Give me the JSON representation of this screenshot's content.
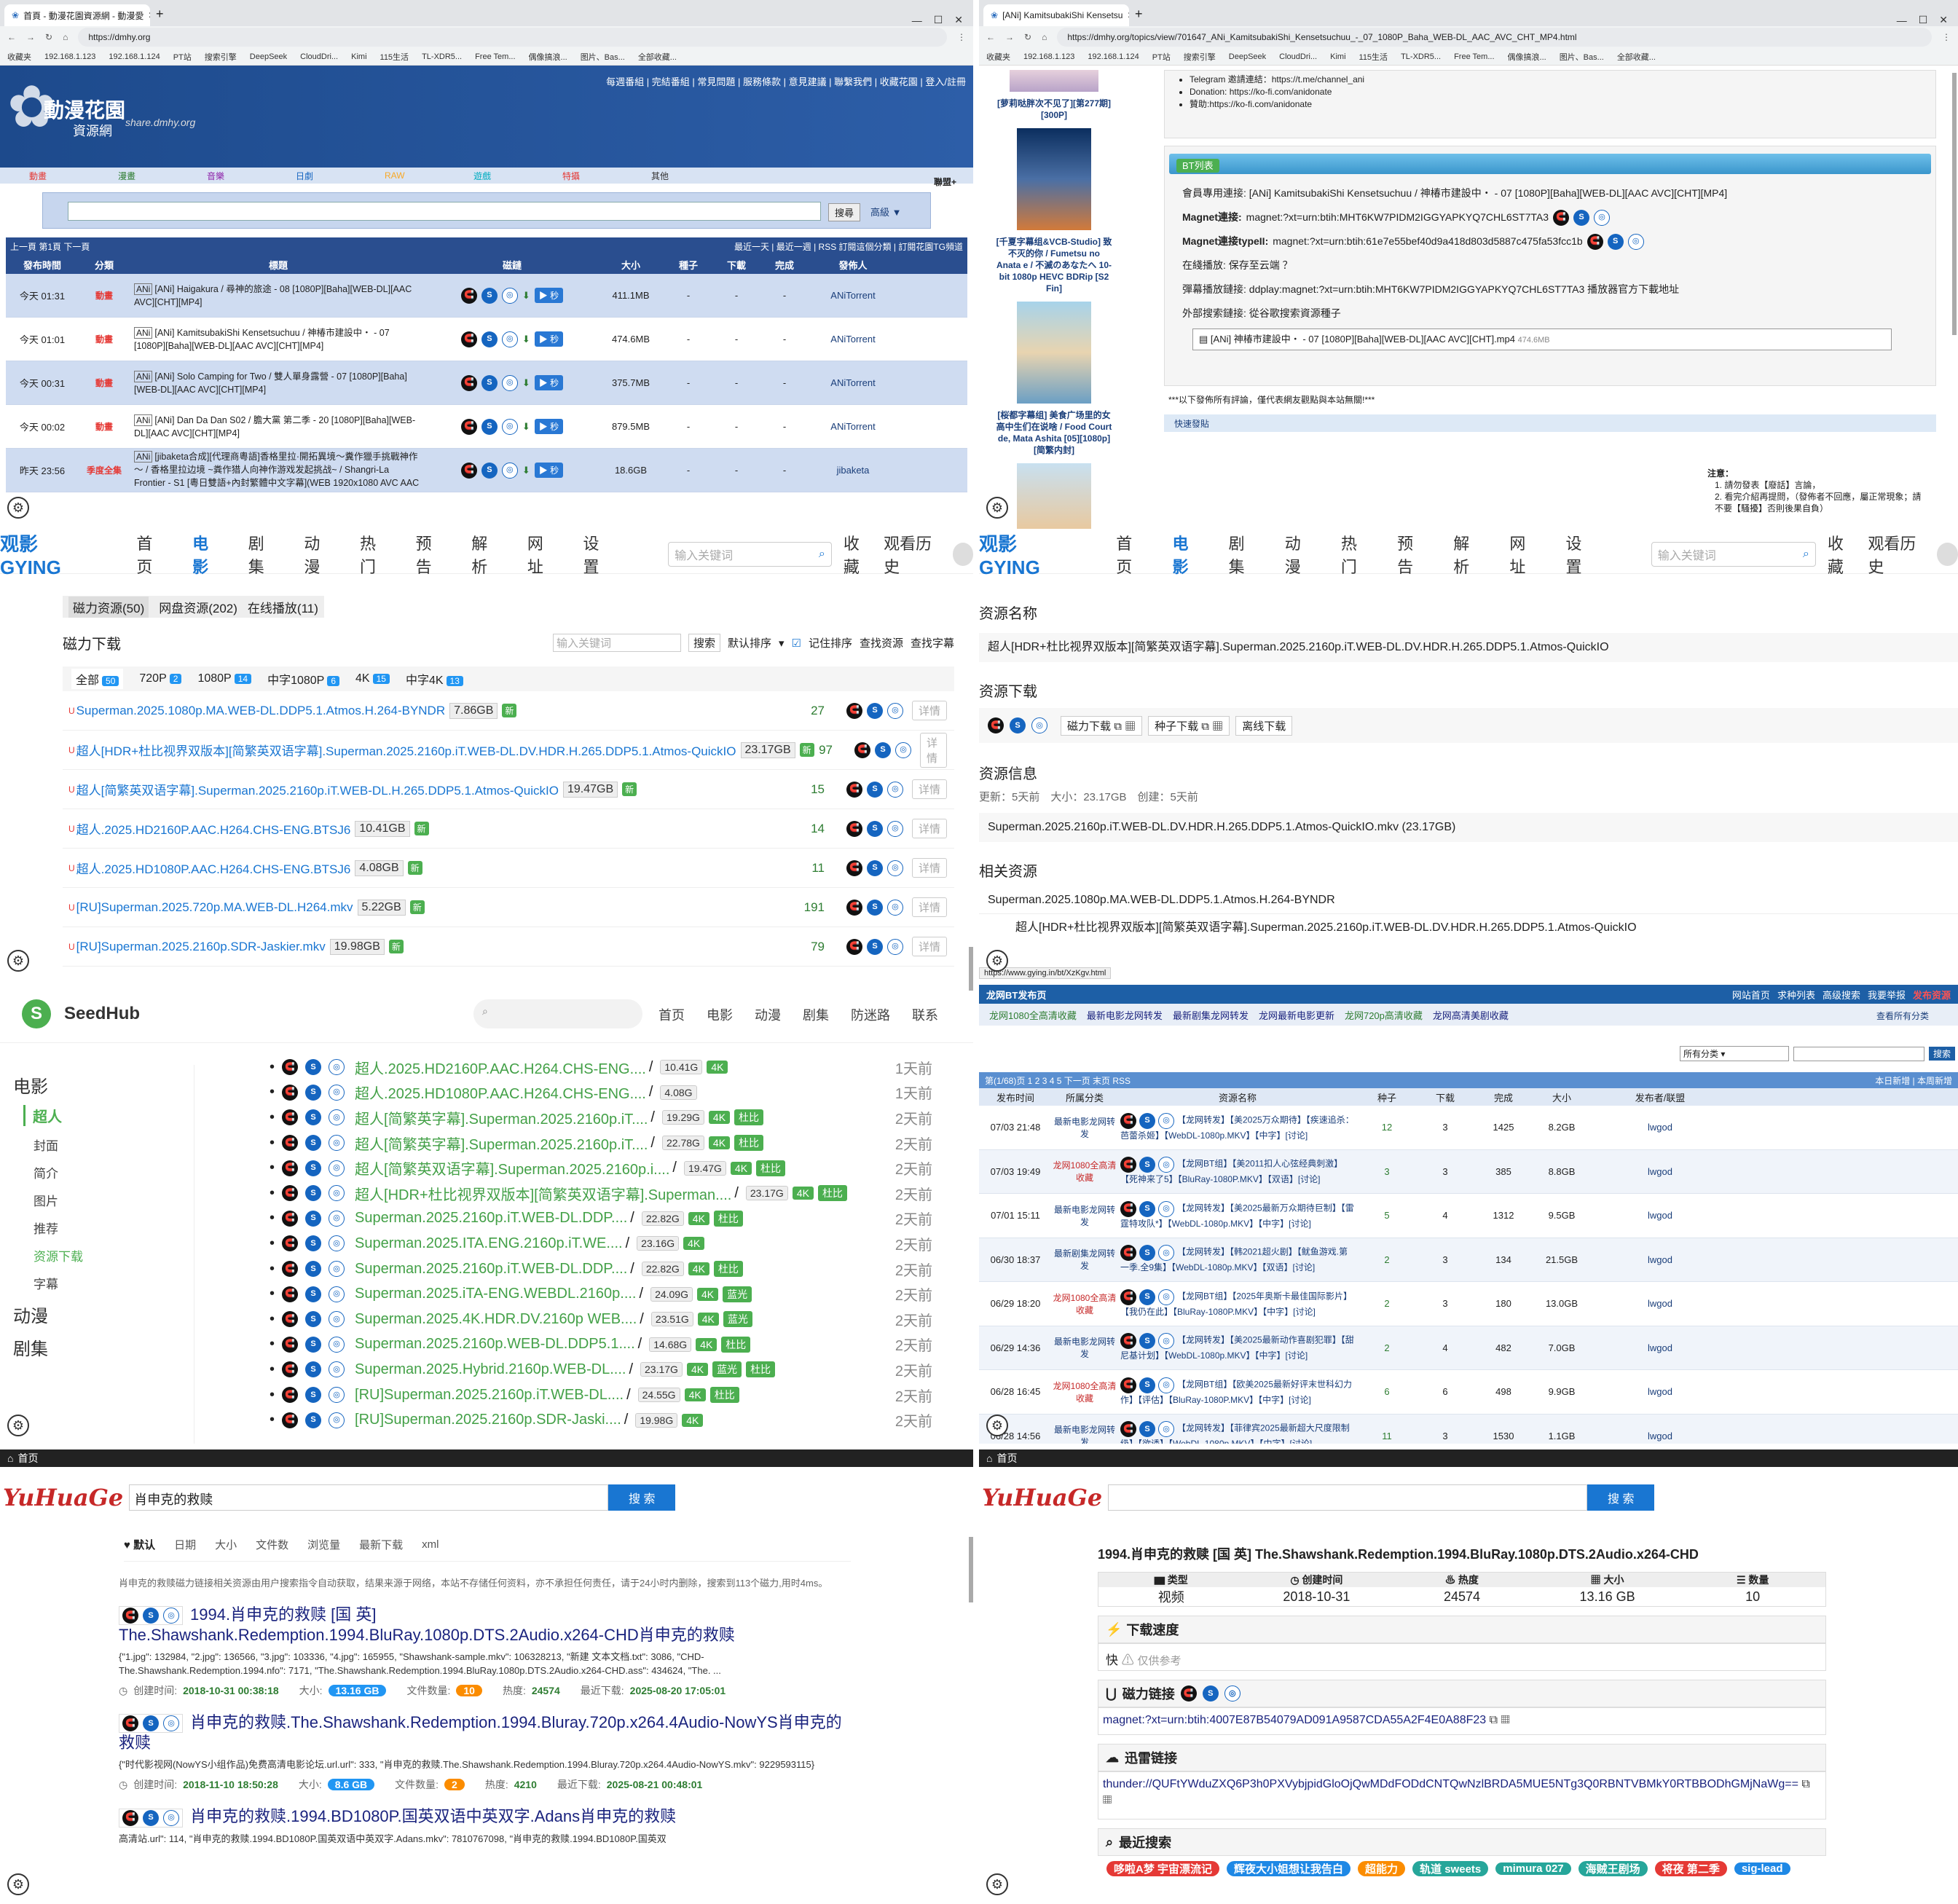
{
  "dmhy": {
    "tab_title": "首頁 - 動漫花園資源網 - 動漫愛",
    "url": "https://dmhy.org",
    "bookmarks": [
      "收藏夹",
      "192.168.1.123",
      "192.168.1.124",
      "PT站",
      "搜索引擎",
      "DeepSeek",
      "CloudDri...",
      "Kimi",
      "115生活",
      "TL-XDR5...",
      "Free Tem...",
      "偶像搞浪...",
      "图片、Bas...",
      "全部收藏..."
    ],
    "logo": "動漫花園",
    "logo_sub": "資源網",
    "logo_url": "share.dmhy.org",
    "toplinks": "每週番組 | 完結番組 | 常見問題 | 服務條款 | 意見建議 | 聯繫我們 | 收藏花園 | 登入/註冊",
    "cats": [
      "動畫",
      "漫畫",
      "音樂",
      "日劇",
      "RAW",
      "遊戲",
      "特攝",
      "其他"
    ],
    "cat_colors": [
      "#e53935",
      "#2e7d32",
      "#8e24aa",
      "#1565c0",
      "#f9a825",
      "#00acc1",
      "#e53935",
      "#333333"
    ],
    "league": "聯盟+",
    "search_btn": "搜尋",
    "adv": "高級 ▼",
    "pager": "上一頁 第1頁 下一頁",
    "bar_right": "最近一天 | 最近一週 | RSS 訂閱這個分類 | 訂閱花園TG頻道",
    "headers": [
      "發布時間",
      "分類",
      "標題",
      "磁鏈",
      "大小",
      "種子",
      "下載",
      "完成",
      "發佈人"
    ],
    "rows": [
      {
        "time": "今天 01:31",
        "cat": "動畫",
        "title": "[ANi] Haigakura / 尋神的旅途 - 08 [1080P][Baha][WEB-DL][AAC AVC][CHT][MP4]",
        "size": "411.1MB",
        "seed": "-",
        "dl": "-",
        "done": "-",
        "pub": "ANiTorrent"
      },
      {
        "time": "今天 01:01",
        "cat": "動畫",
        "title": "[ANi] KamitsubakiShi Kensetsuchuu / 神椿市建設中・ - 07 [1080P][Baha][WEB-DL][AAC AVC][CHT][MP4]",
        "size": "474.6MB",
        "seed": "-",
        "dl": "-",
        "done": "-",
        "pub": "ANiTorrent"
      },
      {
        "time": "今天 00:31",
        "cat": "動畫",
        "title": "[ANi] Solo Camping for Two / 雙人單身露營 - 07 [1080P][Baha][WEB-DL][AAC AVC][CHT][MP4]",
        "size": "375.7MB",
        "seed": "-",
        "dl": "-",
        "done": "-",
        "pub": "ANiTorrent"
      },
      {
        "time": "今天 00:02",
        "cat": "動畫",
        "title": "[ANi] Dan Da Dan S02 / 膽大黨 第二季 - 20 [1080P][Baha][WEB-DL][AAC AVC][CHT][MP4]",
        "size": "879.5MB",
        "seed": "-",
        "dl": "-",
        "done": "-",
        "pub": "ANiTorrent"
      },
      {
        "time": "昨天 23:56",
        "cat": "季度全集",
        "title": "[jibaketa合成][代理商粵語]香格里拉·開拓異境～糞作獵手挑戰神作～ / 香格里拉边境 ~粪作猎人向神作游戏发起挑战~ / Shangri-La Frontier - S1 [粵日雙語+內封繁體中文字幕](WEB 1920x1080 AVC AAC SRT)",
        "size": "18.6GB",
        "seed": "-",
        "dl": "-",
        "done": "-",
        "pub": "jibaketa"
      }
    ],
    "second": "秒"
  },
  "dmhy2": {
    "tab_title": "[ANi] KamitsubakiShi Kensetsu",
    "url": "https://dmhy.org/topics/view/701647_ANi_KamitsubakiShi_Kensetsuchuu_-_07_1080P_Baha_WEB-DL_AAC_AVC_CHT_MP4.html",
    "side": [
      "[萝莉哒胖次不见了][第277期][300P]",
      "[千夏字幕组&VCB-Studio] 致不灭的你 / Fumetsu no Anata e / 不滅のあなたへ 10-bit 1080p HEVC BDRip [S2 Fin]",
      "[桜都字幕组] 美食广场里的女高中生们在说啥 / Food Court de, Mata Ashita [05][1080p][简繁内封]"
    ],
    "info": [
      "Telegram 邀請連結：https://t.me/channel_ani",
      "Donation: https://ko-fi.com/anidonate",
      "贊助:https://ko-fi.com/anidonate"
    ],
    "bt_title": "BT列表",
    "l1": "會員專用連接: [ANi] KamitsubakiShi Kensetsuchuu / 神椿市建設中・ - 07 [1080P][Baha][WEB-DL][AAC AVC][CHT][MP4]",
    "l2k": "Magnet連接:",
    "l2": "magnet:?xt=urn:btih:MHT6KW7PIDM2IGGYAPKYQ7CHL6ST7TA3",
    "l3k": "Magnet連接typeII:",
    "l3": "magnet:?xt=urn:btih:61e7e55bef40d9a418d803d5887c475fa53fcc1b",
    "l4": "在綫播放: 保存至云端 ？",
    "l5": "彈幕播放鏈接: ddplay:magnet:?xt=urn:btih:MHT6KW7PIDM2IGGYAPKYQ7CHL6ST7TA3 播放器官方下載地址",
    "l6": "外部搜索鏈接: 從谷歌搜索資源種子",
    "file": "[ANi] 神椿市建設中・ - 07 [1080P][Baha][WEB-DL][AAC AVC][CHT].mp4",
    "file_size": "474.6MB",
    "notice": "***以下發佈所有評論，僅代表網友觀點與本站無關!***",
    "quick": "快速發貼",
    "note_h": "注意：",
    "notes": [
      "1. 請勿發表【廢話】言論，",
      "2. 看完介紹再提問，（發佈者不回應，屬正常現象；請不要【騷擾】否則後果自負）"
    ]
  },
  "gying": {
    "logo": "观影 GYING",
    "nav": [
      "首页",
      "电影",
      "剧集",
      "动漫",
      "热门",
      "预告",
      "解析",
      "网址",
      "设置"
    ],
    "search_ph": "输入关键词",
    "nav_right": [
      "收藏",
      "观看历史"
    ],
    "tabs": [
      "磁力资源(50)",
      "网盘资源(202)",
      "在线播放(11)"
    ],
    "section": "磁力下载",
    "filter_ph": "输入关键词",
    "filter_btn": "搜索",
    "sort": "默认排序",
    "remember": "记住排序",
    "find_res": "查找资源",
    "find_sub": "查找字幕",
    "qtabs": [
      {
        "l": "全部",
        "n": "50"
      },
      {
        "l": "720P",
        "n": "2"
      },
      {
        "l": "1080P",
        "n": "14"
      },
      {
        "l": "中字1080P",
        "n": "6"
      },
      {
        "l": "4K",
        "n": "15"
      },
      {
        "l": "中字4K",
        "n": "13"
      }
    ],
    "new": "新",
    "detail": "详情",
    "rows": [
      {
        "t": "Superman.2025.1080p.MA.WEB-DL.DDP5.1.Atmos.H.264-BYNDR",
        "s": "7.86GB",
        "n": "27"
      },
      {
        "t": "超人[HDR+杜比视界双版本][简繁英双语字幕].Superman.2025.2160p.iT.WEB-DL.DV.HDR.H.265.DDP5.1.Atmos-QuickIO",
        "s": "23.17GB",
        "n": "97"
      },
      {
        "t": "超人[简繁英双语字幕].Superman.2025.2160p.iT.WEB-DL.H.265.DDP5.1.Atmos-QuickIO",
        "s": "19.47GB",
        "n": "15"
      },
      {
        "t": "超人.2025.HD2160P.AAC.H264.CHS-ENG.BTSJ6",
        "s": "10.41GB",
        "n": "14"
      },
      {
        "t": "超人.2025.HD1080P.AAC.H264.CHS-ENG.BTSJ6",
        "s": "4.08GB",
        "n": "11"
      },
      {
        "t": "[RU]Superman.2025.720p.MA.WEB-DL.H264.mkv",
        "s": "5.22GB",
        "n": "191"
      },
      {
        "t": "[RU]Superman.2025.2160p.SDR-Jaskier.mkv",
        "s": "19.98GB",
        "n": "79"
      }
    ]
  },
  "gying2": {
    "h1": "资源名称",
    "name": "超人[HDR+杜比视界双版本][简繁英双语字幕].Superman.2025.2160p.iT.WEB-DL.DV.HDR.H.265.DDP5.1.Atmos-QuickIO",
    "h2": "资源下载",
    "btns": [
      "磁力下载",
      "复",
      "种子下载",
      "复",
      "离线下载"
    ],
    "h3": "资源信息",
    "meta": "更新：5天前　大小：23.17GB　创建：5天前",
    "file": "Superman.2025.2160p.iT.WEB-DL.DV.HDR.H.265.DDP5.1.Atmos-QuickIO.mkv (23.17GB)",
    "h4": "相关资源",
    "rel": [
      "Superman.2025.1080p.MA.WEB-DL.DDP5.1.Atmos.H.264-BYNDR",
      "超人[HDR+杜比视界双版本][简繁英双语字幕].Superman.2025.2160p.iT.WEB-DL.DV.HDR.H.265.DDP5.1.Atmos-QuickIO"
    ],
    "status": "https://www.gying.in/bt/XzKgv.html"
  },
  "seedhub": {
    "logo": "SeedHub",
    "nav": [
      "首页",
      "电影",
      "动漫",
      "剧集",
      "防迷路",
      "联系"
    ],
    "side": [
      "电影",
      "超人",
      "封面",
      "简介",
      "图片",
      "推荐",
      "资源下载",
      "字幕",
      "动漫",
      "剧集"
    ],
    "rows": [
      {
        "t": "超人.2025.HD2160P.AAC.H264.CHS-ENG....",
        "s": "10.41G",
        "tags": [
          "4K"
        ],
        "d": "1天前"
      },
      {
        "t": "超人.2025.HD1080P.AAC.H264.CHS-ENG....",
        "s": "4.08G",
        "tags": [],
        "d": "1天前"
      },
      {
        "t": "超人[简繁英字幕].Superman.2025.2160p.iT....",
        "s": "19.29G",
        "tags": [
          "4K",
          "杜比"
        ],
        "d": "2天前"
      },
      {
        "t": "超人[简繁英字幕].Superman.2025.2160p.iT....",
        "s": "22.78G",
        "tags": [
          "4K",
          "杜比"
        ],
        "d": "2天前"
      },
      {
        "t": "超人[简繁英双语字幕].Superman.2025.2160p.i....",
        "s": "19.47G",
        "tags": [
          "4K",
          "杜比"
        ],
        "d": "2天前"
      },
      {
        "t": "超人[HDR+杜比视界双版本][简繁英双语字幕].Superman....",
        "s": "23.17G",
        "tags": [
          "4K",
          "杜比"
        ],
        "d": "2天前"
      },
      {
        "t": "Superman.2025.2160p.iT.WEB-DL.DDP....",
        "s": "22.82G",
        "tags": [
          "4K",
          "杜比"
        ],
        "d": "2天前"
      },
      {
        "t": "Superman.2025.ITA.ENG.2160p.iT.WE....",
        "s": "23.16G",
        "tags": [
          "4K"
        ],
        "d": "2天前"
      },
      {
        "t": "Superman.2025.2160p.iT.WEB-DL.DDP....",
        "s": "22.82G",
        "tags": [
          "4K",
          "杜比"
        ],
        "d": "2天前"
      },
      {
        "t": "Superman.2025.iTA-ENG.WEBDL.2160p....",
        "s": "24.09G",
        "tags": [
          "4K",
          "蓝光"
        ],
        "d": "2天前"
      },
      {
        "t": "Superman.2025.4K.HDR.DV.2160p WEB....",
        "s": "23.51G",
        "tags": [
          "4K",
          "蓝光"
        ],
        "d": "2天前"
      },
      {
        "t": "Superman.2025.2160p.WEB-DL.DDP5.1....",
        "s": "14.68G",
        "tags": [
          "4K",
          "杜比"
        ],
        "d": "2天前"
      },
      {
        "t": "Superman.2025.Hybrid.2160p.WEB-DL....",
        "s": "23.17G",
        "tags": [
          "4K",
          "蓝光",
          "杜比"
        ],
        "d": "2天前"
      },
      {
        "t": "[RU]Superman.2025.2160p.iT.WEB-DL....",
        "s": "24.55G",
        "tags": [
          "4K",
          "杜比"
        ],
        "d": "2天前"
      },
      {
        "t": "[RU]Superman.2025.2160p.SDR-Jaski....",
        "s": "19.98G",
        "tags": [
          "4K"
        ],
        "d": "2天前"
      }
    ]
  },
  "lw": {
    "title": "龙网BT发布页",
    "right": [
      "网站首页",
      "求种列表",
      "高级搜索",
      "我要举报",
      "发布资源"
    ],
    "links": [
      "龙网1080全高清收藏",
      "最新电影龙网转发",
      "最新剧集龙网转发",
      "龙网最新电影更新",
      "龙网720p高清收藏",
      "龙网高清美剧收藏"
    ],
    "link_colors": [
      "#2e7d32",
      "#1a237e",
      "#1a237e",
      "#1a237e",
      "#2e7d32",
      "#1a237e"
    ],
    "view_all": "查看所有分类",
    "cat_sel": "所有分类",
    "search_btn": "搜索",
    "pager": "第(1/68)页 1 2 3 4 5 下一页 末页 RSS",
    "pager_right": "本日新增 | 本周新增",
    "headers": [
      "发布时间",
      "所属分类",
      "资源名称",
      "种子",
      "下载",
      "完成",
      "大小",
      "发布者/联盟"
    ],
    "rows": [
      {
        "t": "07/03 21:48",
        "c": "最新电影龙网转发",
        "n": "【龙网转发】【美2025万众期待】【疾速追杀：芭蕾杀姬】【WebDL-1080p.MKV】【中字】[讨论]",
        "s": "12",
        "d": "3",
        "f": "1425",
        "z": "8.2GB"
      },
      {
        "t": "07/03 19:49",
        "c": "龙网1080全高清收藏",
        "n": "【龙网BT组】【美2011扣人心弦经典刺激】【死神来了5】【BluRay-1080P.MKV】【双语】[讨论]",
        "s": "3",
        "d": "3",
        "f": "385",
        "z": "8.8GB"
      },
      {
        "t": "07/01 15:11",
        "c": "最新电影龙网转发",
        "n": "【龙网转发】【美2025最新万众期待巨制】【雷霆特攻队*】【WebDL-1080p.MKV】【中字】[讨论]",
        "s": "5",
        "d": "4",
        "f": "1312",
        "z": "9.5GB"
      },
      {
        "t": "06/30 18:37",
        "c": "最新剧集龙网转发",
        "n": "【龙网转发】【韩2021超火剧】【鱿鱼游戏.第一季.全9集】【WebDL-1080p.MKV】【双语】[讨论]",
        "s": "2",
        "d": "3",
        "f": "134",
        "z": "21.5GB"
      },
      {
        "t": "06/29 18:20",
        "c": "龙网1080全高清收藏",
        "n": "【龙网BT组】【2025年奥斯卡最佳国际影片】【我仍在此】【BluRay-1080P.MKV】【中字】[讨论]",
        "s": "2",
        "d": "3",
        "f": "180",
        "z": "13.0GB"
      },
      {
        "t": "06/29 14:36",
        "c": "最新电影龙网转发",
        "n": "【龙网转发】【美2025最新动作喜剧犯罪】【甜尼基计划】【WebDL-1080p.MKV】【中字】[讨论]",
        "s": "2",
        "d": "4",
        "f": "482",
        "z": "7.0GB"
      },
      {
        "t": "06/28 16:45",
        "c": "龙网1080全高清收藏",
        "n": "【龙网BT组】【欧美2025最新好评末世科幻力作】【评估】【BluRay-1080P.MKV】【中字】[讨论]",
        "s": "6",
        "d": "6",
        "f": "498",
        "z": "9.9GB"
      },
      {
        "t": "06/28 14:56",
        "c": "最新电影龙网转发",
        "n": "【龙网转发】【菲律宾2025最新超大尺度限制级】【欲诱】【WebDL-1080p.MKV】【中字】[讨论]",
        "s": "11",
        "d": "3",
        "f": "1530",
        "z": "1.1GB"
      }
    ],
    "pub": "lwgod"
  },
  "yh": {
    "home": "首页",
    "logo": "YuHuaGe",
    "query": "肖申克的救赎",
    "search_btn": "搜 索",
    "sorts": [
      "默认",
      "日期",
      "大小",
      "文件数",
      "浏览量",
      "最新下载",
      "xml"
    ],
    "desc": "肖申克的救赎磁力链接相关资源由用户搜索指令自动获取，结果来源于网络，本站不存储任何资料，亦不承担任何责任，请于24小时内删除，搜索到113个磁力,用时4ms。",
    "results": [
      {
        "title": "1994.肖申克的救赎 [国 英] The.Shawshank.Redemption.1994.BluRay.1080p.DTS.2Audio.x264-CHD肖申克的救赎",
        "snip": "{\"1.jpg\": 132984, \"2.jpg\": 136566, \"3.jpg\": 103336, \"4.jpg\": 165955, \"Shawshank-sample.mkv\": 106328213, \"新建 文本文档.txt\": 3086, \"CHD-The.Shawshank.Redemption.1994.nfo\": 7171, \"The.Shawshank.Redemption.1994.BluRay.1080p.DTS.2Audio.x264-CHD.ass\": 434624, \"The. ...",
        "created": "2018-10-31 00:38:18",
        "size": "13.16 GB",
        "files": "10",
        "heat": "24574",
        "last": "2025-08-20 17:05:01"
      },
      {
        "title": "肖申克的救赎.The.Shawshank.Redemption.1994.Bluray.720p.x264.4Audio-NowYS肖申克的救赎",
        "snip": "{\"时代影视网(NowYS小组作品)免费高清电影论坛.url.url\": 333, \"肖申克的救赎.The.Shawshank.Redemption.1994.Bluray.720p.x264.4Audio-NowYS.mkv\": 9229593115}",
        "created": "2018-11-10 18:50:28",
        "size": "8.6 GB",
        "files": "2",
        "heat": "4210",
        "last": "2025-08-21 00:48:01"
      },
      {
        "title": "肖申克的救赎.1994.BD1080P.国英双语中英双字.Adans肖申克的救赎",
        "snip": "高清站.url\": 114, \"肖申克的救赎.1994.BD1080P.国英双语中英双字.Adans.mkv\": 7810767098, \"肖申克的救赎.1994.BD1080P.国英双",
        "created": "",
        "size": "",
        "files": "",
        "heat": "",
        "last": ""
      }
    ],
    "lbl": {
      "created": "创建时间:",
      "size": "大小:",
      "files": "文件数量:",
      "heat": "热度:",
      "last": "最近下载:"
    }
  },
  "yh2": {
    "home": "首页",
    "logo": "YuHuaGe",
    "search_btn": "搜 索",
    "title": "1994.肖申克的救赎 [国 英] The.Shawshank.Redemption.1994.BluRay.1080p.DTS.2Audio.x264-CHD",
    "heads": [
      "类型",
      "创建时间",
      "热度",
      "大小",
      "数量"
    ],
    "vals": [
      "视频",
      "2018-10-31",
      "24574",
      "13.16 GB",
      "10"
    ],
    "speed_h": "下载速度",
    "speed": "快",
    "speed_note": "仅供参考",
    "mag_h": "磁力链接",
    "mag": "magnet:?xt=urn:btih:4007E87B54079AD091A9587CDA55A2F4E0A88F23",
    "xl_h": "迅雷链接",
    "xl": "thunder://QUFtYWduZXQ6P3h0PXVybjpidGloOjQwMDdFODdCNTQwNzlBRDA5MUE5NTg3Q0RBNTVBMkY0RTBBODhGMjNaWg==",
    "recent_h": "最近搜索",
    "recent": [
      "哆啦A梦 宇宙漂流记",
      "辉夜大小姐想让我告白",
      "超能力",
      "轨道 sweets",
      "mimura 027",
      "海贼王剧场",
      "将夜 第二季",
      "sig-lead"
    ],
    "recent_colors": [
      "#e53935",
      "#1e88e5",
      "#fb8c00",
      "#26a69a",
      "#26a69a",
      "#26a69a",
      "#e53935",
      "#1e88e5"
    ]
  }
}
